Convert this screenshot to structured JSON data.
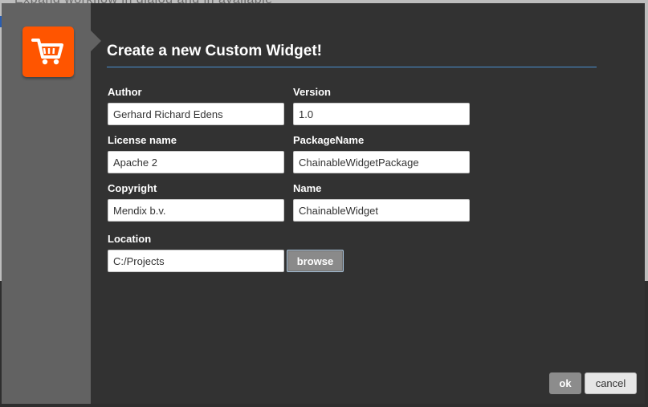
{
  "background": {
    "partial_text": "Expand workflow in dialog and in available"
  },
  "dialog": {
    "title": "Create a new Custom Widget!",
    "accent_color": "#4a8fd0",
    "logo_color": "#ff5500",
    "logo_icon": "shopping-cart-icon",
    "fields": {
      "author": {
        "label": "Author",
        "value": "Gerhard Richard Edens"
      },
      "version": {
        "label": "Version",
        "value": "1.0"
      },
      "license_name": {
        "label": "License name",
        "value": "Apache 2"
      },
      "package_name": {
        "label": "PackageName",
        "value": "ChainableWidgetPackage"
      },
      "copyright": {
        "label": "Copyright",
        "value": "Mendix b.v."
      },
      "name": {
        "label": "Name",
        "value": "ChainableWidget"
      },
      "location": {
        "label": "Location",
        "value": "C:/Projects"
      }
    },
    "browse_label": "browse",
    "ok_label": "ok",
    "cancel_label": "cancel"
  }
}
